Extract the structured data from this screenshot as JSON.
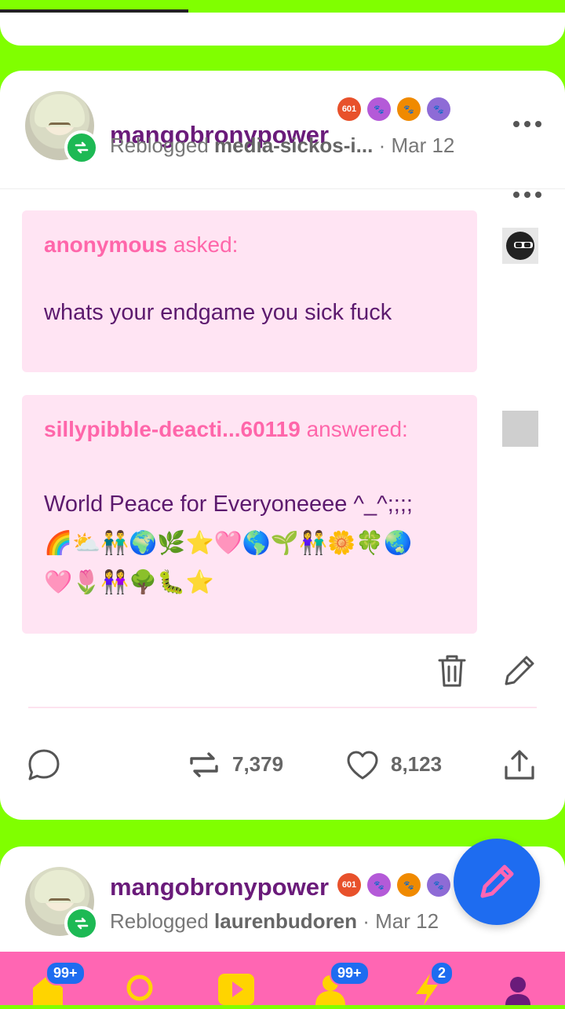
{
  "post1": {
    "username": "mangobronypower",
    "reblogged_label": "Reblogged",
    "source": "media-sickos-i...",
    "date": "· Mar 12",
    "ask": {
      "asker": "anonymous",
      "asked_label": "asked:",
      "question": "whats your endgame you sick fuck"
    },
    "answer": {
      "answerer": "sillypibble-deacti...60119",
      "answered_label": "answered:",
      "text_line1": "World Peace for Everyoneeee ^_^;;;;",
      "emoji_line1": "🌈⛅👬🌍🌿⭐🩷🌎🌱👫🌼🍀🌏",
      "emoji_line2": "🩷🌷👭🌳🐛⭐"
    },
    "reblog_count": "7,379",
    "like_count": "8,123"
  },
  "post2": {
    "username": "mangobronypower",
    "reblogged_label": "Reblogged",
    "source": "laurenbudoren",
    "date": "· Mar 12"
  },
  "nav": {
    "home_badge": "99+",
    "activity_badge": "99+",
    "lightning_badge": "2"
  },
  "colors": {
    "background": "#80ff00",
    "nav": "#ff66b3",
    "fab": "#1e6cf0",
    "bubble": "#ffe4f3",
    "username": "#6a1b7a"
  }
}
